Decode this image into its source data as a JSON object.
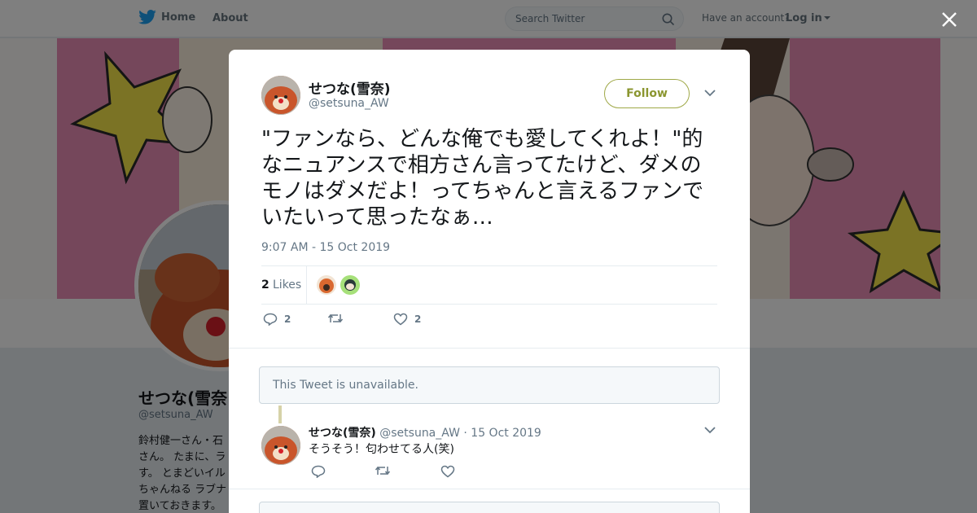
{
  "nav": {
    "home_label": "Home",
    "about_label": "About",
    "search_placeholder": "Search Twitter",
    "account_prompt": "Have an account?",
    "login_label": "Log in"
  },
  "colors": {
    "twitter_blue": "#1da1f2",
    "follow_accent": "#8b9630",
    "banner_pink": "#eb8fb7",
    "muted": "#657786"
  },
  "background_profile": {
    "name": "せつな(雪奈",
    "handle": "@setsuna_AW",
    "bio": "鈴村健一さん・石さん。 たまに、ラす。 とまどいイルちゃんねる ラブナ置いておきます。"
  },
  "tweet": {
    "author_name": "せつな(雪奈)",
    "author_handle": "@setsuna_AW",
    "follow_label": "Follow",
    "text": "\"ファンなら、どんな俺でも愛してくれよ！\"的なニュアンスで相方さん言ってたけど、ダメのモノはダメだよ！ってちゃんと言えるファンでいたいって思ったなぁ…",
    "timestamp": "9:07 AM - 15 Oct 2019",
    "likes_count": "2",
    "likes_label": "Likes",
    "reply_count": "2",
    "like_count": "2"
  },
  "unavailable_notice": "This Tweet is unavailable.",
  "reply": {
    "author_name": "せつな(雪奈)",
    "author_handle": "@setsuna_AW",
    "date": "15 Oct 2019",
    "separator": "·",
    "text": "そうそう！匂わせてる人(笑)"
  },
  "icons": [
    "twitter-bird-icon",
    "search-icon",
    "caret-down-icon",
    "close-icon",
    "chevron-down-icon",
    "reply-icon",
    "retweet-icon",
    "heart-icon"
  ]
}
